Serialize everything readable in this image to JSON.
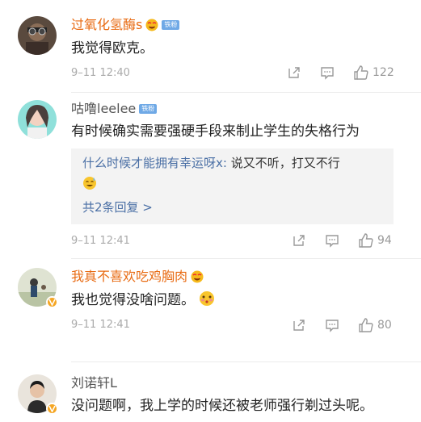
{
  "comments": [
    {
      "name": "过氧化氢酶s",
      "level_badge": "铁粉",
      "text": "我觉得欧克。",
      "time": "9–11 12:40",
      "likes": "122"
    },
    {
      "name": "咕噜leelee",
      "level_badge": "铁粉",
      "text": "有时候确实需要强硬手段来制止学生的失格行为",
      "reply": {
        "user": "什么时候才能拥有幸运呀x:",
        "text": " 说又不听，打又不行",
        "more": "共2条回复 >"
      },
      "time": "9–11 12:41",
      "likes": "94"
    },
    {
      "name": "我真不喜欢吃鸡胸肉",
      "text": "我也觉得没啥问题。",
      "time": "9–11 12:41",
      "likes": "80"
    },
    {
      "name": "刘诺轩L",
      "text": "没问题啊，我上学的时候还被老师强行剃过头呢。"
    }
  ],
  "icons": {
    "share": "share-icon",
    "reply": "reply-icon",
    "like": "thumbs-up-icon",
    "vip": "vip-emoji-icon",
    "verified": "verified-badge-icon"
  },
  "colors": {
    "vip_name": "#e86b13",
    "link": "#4a6fa5",
    "level_badge": "#6fa9e6",
    "meta": "#aaaaaa"
  }
}
